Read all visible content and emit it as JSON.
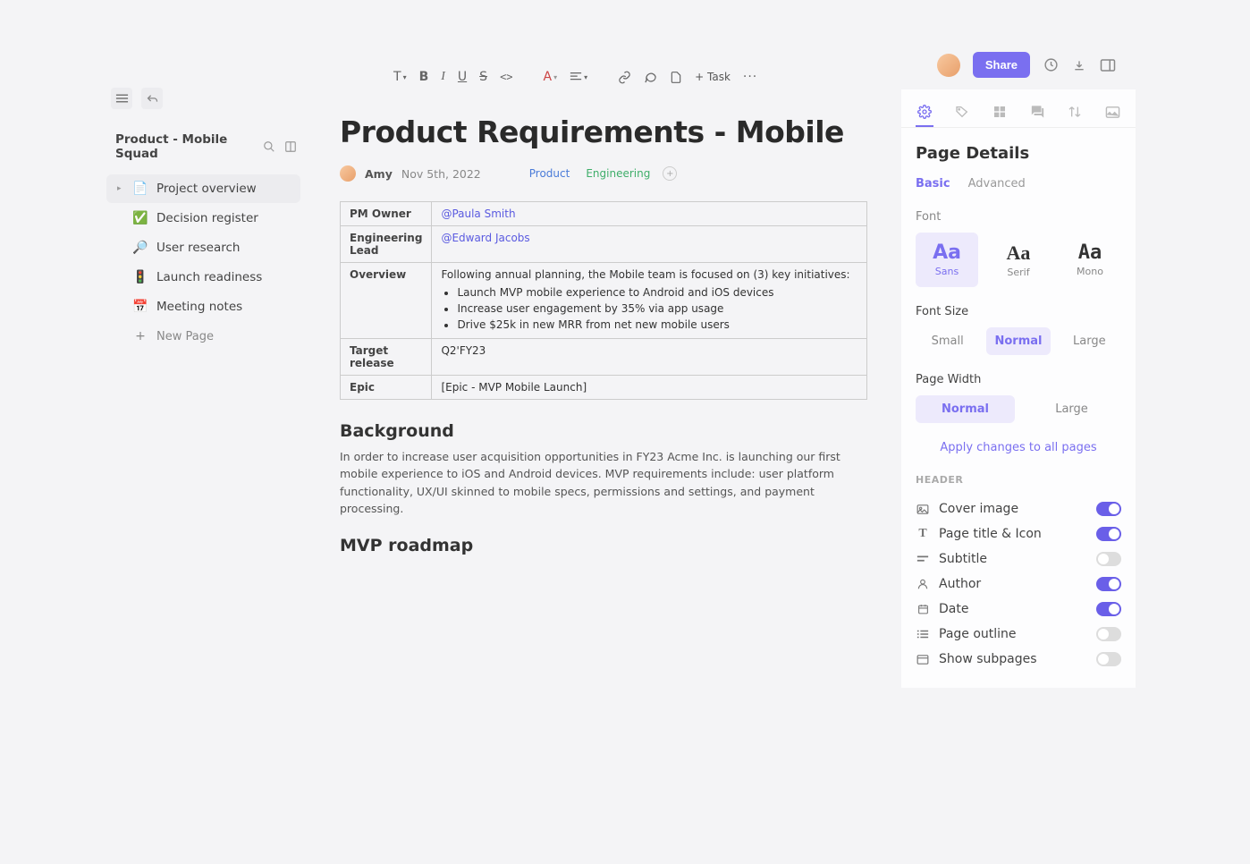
{
  "topActions": {
    "shareLabel": "Share"
  },
  "toolbar": {
    "textMenu": "T",
    "bold": "B",
    "italic": "I",
    "underline": "U",
    "strike": "S",
    "code": "<>",
    "textColor": "A",
    "taskLabel": "+ Task",
    "more": "···"
  },
  "sidebar": {
    "title": "Product - Mobile Squad",
    "items": [
      {
        "icon": "📄",
        "label": "Project overview",
        "active": true,
        "expandable": true
      },
      {
        "icon": "✅",
        "label": "Decision register"
      },
      {
        "icon": "🔎",
        "label": "User research"
      },
      {
        "icon": "🚦",
        "label": "Launch readiness"
      },
      {
        "icon": "📅",
        "label": "Meeting notes"
      }
    ],
    "newPage": "New Page"
  },
  "page": {
    "title": "Product Requirements - Mobile",
    "author": "Amy",
    "date": "Nov 5th, 2022",
    "tags": {
      "product": "Product",
      "engineering": "Engineering"
    },
    "table": {
      "rows": [
        {
          "k": "PM Owner",
          "mention": "@Paula Smith"
        },
        {
          "k": "Engineering Lead",
          "mention": "@Edward Jacobs"
        }
      ],
      "overviewKey": "Overview",
      "overviewLead": "Following annual planning, the Mobile team is focused on (3) key initiatives:",
      "overviewBullets": [
        "Launch MVP mobile experience to Android and iOS devices",
        "Increase user engagement by 35% via app usage",
        "Drive $25k in new MRR from net new mobile users"
      ],
      "targetKey": "Target release",
      "targetVal": "Q2'FY23",
      "epicKey": "Epic",
      "epicVal": "[Epic - MVP Mobile Launch]"
    },
    "backgroundTitle": "Background",
    "backgroundBody": "In order to increase user acquisition opportunities in FY23 Acme Inc. is launching our first mobile experience to iOS and Android devices. MVP requirements include: user platform functionality, UX/UI skinned to mobile specs, permissions and settings, and payment processing.",
    "roadmapTitle": "MVP roadmap"
  },
  "panel": {
    "title": "Page Details",
    "tabs": {
      "basic": "Basic",
      "advanced": "Advanced"
    },
    "fontLabel": "Font",
    "fontOptions": [
      {
        "aa": "Aa",
        "label": "Sans",
        "active": true
      },
      {
        "aa": "Aa",
        "label": "Serif"
      },
      {
        "aa": "Aa",
        "label": "Mono"
      }
    ],
    "fontSizeLabel": "Font Size",
    "fontSizes": [
      {
        "label": "Small"
      },
      {
        "label": "Normal",
        "active": true
      },
      {
        "label": "Large"
      }
    ],
    "pageWidthLabel": "Page Width",
    "pageWidths": [
      {
        "label": "Normal",
        "active": true
      },
      {
        "label": "Large"
      }
    ],
    "applyLink": "Apply changes to all pages",
    "headerLabel": "HEADER",
    "toggles": [
      {
        "label": "Cover image",
        "on": true,
        "icon": "image"
      },
      {
        "label": "Page title & Icon",
        "on": true,
        "icon": "title"
      },
      {
        "label": "Subtitle",
        "on": false,
        "icon": "subtitle"
      },
      {
        "label": "Author",
        "on": true,
        "icon": "author"
      },
      {
        "label": "Date",
        "on": true,
        "icon": "date"
      },
      {
        "label": "Page outline",
        "on": false,
        "icon": "outline"
      },
      {
        "label": "Show subpages",
        "on": false,
        "icon": "subpages"
      }
    ]
  }
}
